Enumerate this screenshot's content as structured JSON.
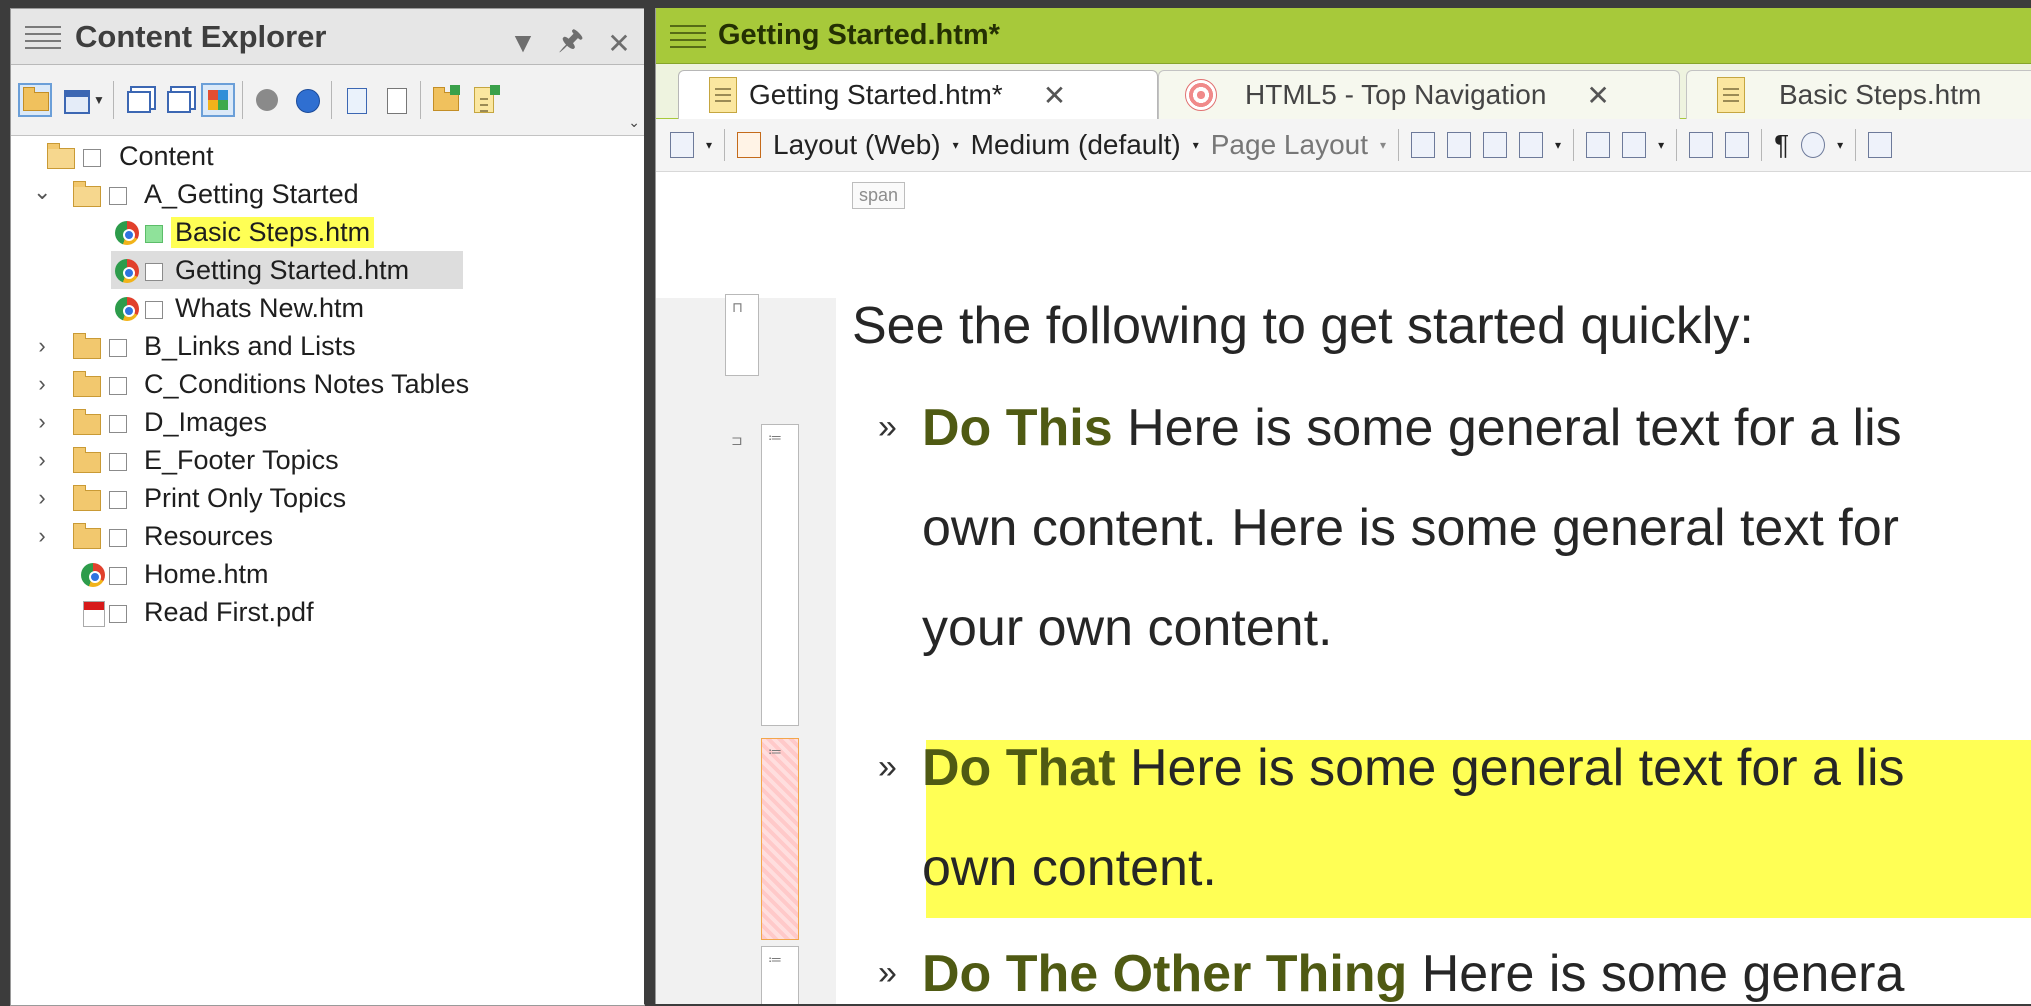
{
  "content_explorer": {
    "title": "Content Explorer",
    "pin_glyph": "🖈",
    "close_glyph": "✕",
    "menu_glyph": "▼",
    "tree": [
      {
        "label": "Content",
        "kind": "root-folder"
      },
      {
        "label": "A_Getting Started",
        "kind": "folder",
        "expanded": true
      },
      {
        "label": "Basic Steps.htm",
        "kind": "topic",
        "highlight": "yellow"
      },
      {
        "label": "Getting Started.htm",
        "kind": "topic",
        "selected": true
      },
      {
        "label": "Whats New.htm",
        "kind": "topic"
      },
      {
        "label": "B_Links and Lists",
        "kind": "folder"
      },
      {
        "label": "C_Conditions Notes Tables",
        "kind": "folder"
      },
      {
        "label": "D_Images",
        "kind": "folder"
      },
      {
        "label": "E_Footer Topics",
        "kind": "folder"
      },
      {
        "label": "Print Only Topics",
        "kind": "folder"
      },
      {
        "label": "Resources",
        "kind": "folder"
      },
      {
        "label": "Home.htm",
        "kind": "topic"
      },
      {
        "label": "Read First.pdf",
        "kind": "pdf"
      }
    ],
    "expanded_glyph": "⌄",
    "collapsed_glyph": "›"
  },
  "editor": {
    "window_title": "Getting Started.htm*",
    "tabs": [
      {
        "label": "Getting Started.htm*",
        "icon": "topic-doc-icon",
        "active": true,
        "close": "✕"
      },
      {
        "label": "HTML5 - Top Navigation",
        "icon": "target-icon",
        "active": false,
        "close": "✕"
      },
      {
        "label": "Basic Steps.htm",
        "icon": "topic-doc-icon",
        "active": false
      }
    ],
    "toolbar": {
      "layout": "Layout (Web)",
      "medium": "Medium (default)",
      "page_layout": "Page Layout",
      "dd": "▾",
      "pilcrow": "¶"
    },
    "span_tag": "span",
    "body": {
      "intro": "See the following to get started quickly:",
      "bullet_glyph": "»",
      "items": [
        {
          "strong": "Do This",
          "lines": [
            " Here is some general text for a lis",
            "own content. Here is some general text for",
            "your own content."
          ]
        },
        {
          "strong": "Do That",
          "lines": [
            " Here is some general text for a lis",
            "own content."
          ],
          "highlight": "yellow"
        },
        {
          "strong": "Do The Other Thing",
          "lines": [
            " Here is some genera"
          ]
        }
      ]
    }
  },
  "colors": {
    "accent_green": "#a7c93a",
    "highlight_yellow": "#ffff55",
    "strong_text": "#4f5a13"
  }
}
